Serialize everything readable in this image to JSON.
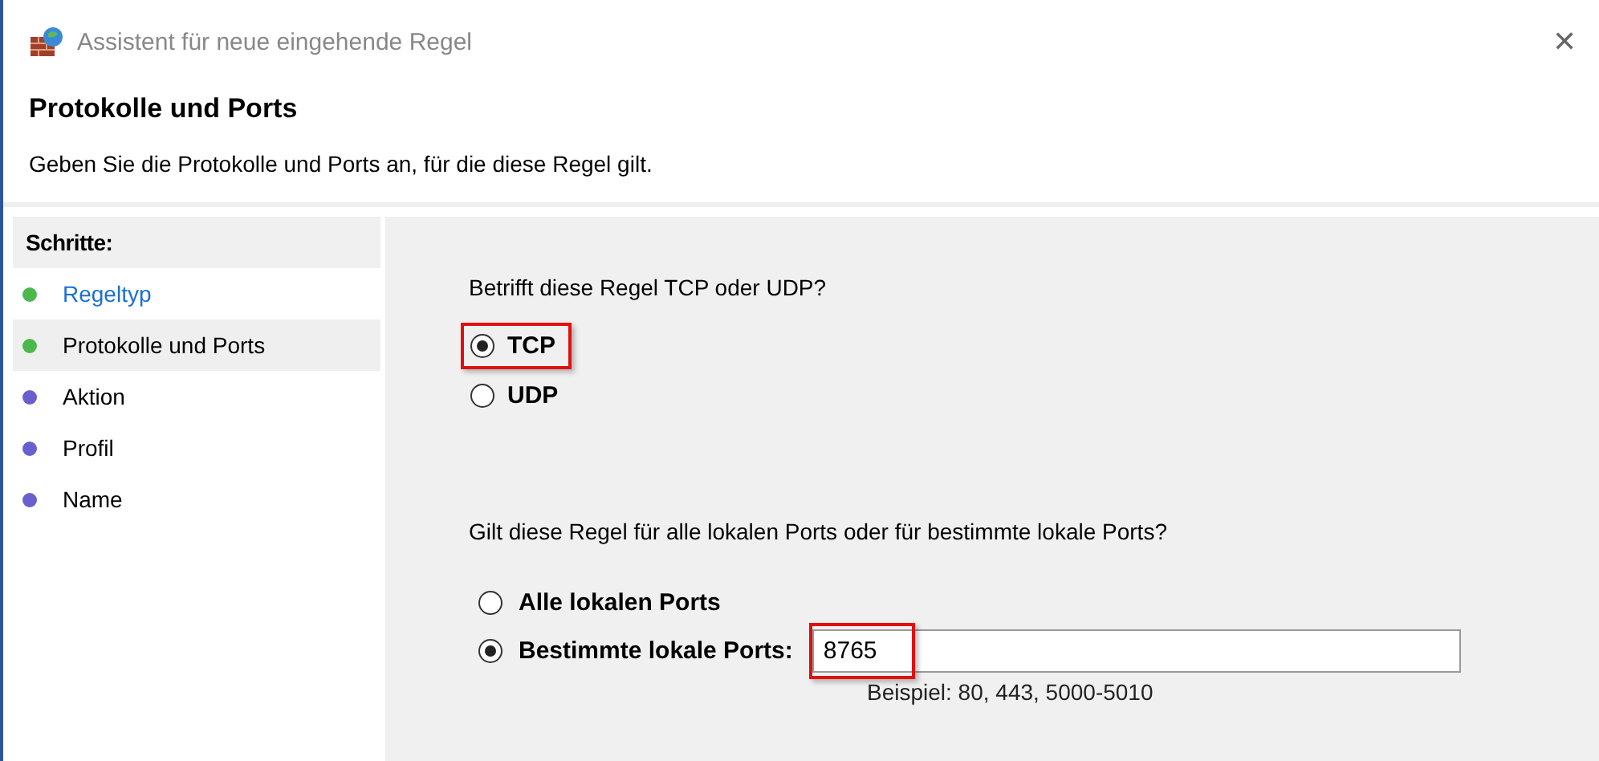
{
  "window": {
    "title": "Assistent für neue eingehende Regel",
    "close": "✕"
  },
  "header": {
    "title": "Protokolle und Ports",
    "description": "Geben Sie die Protokolle und Ports an, für die diese Regel gilt."
  },
  "steps": {
    "heading": "Schritte:",
    "items": [
      {
        "label": "Regeltyp",
        "color": "#4cb84c",
        "selected": false,
        "kind": "link"
      },
      {
        "label": "Protokolle und Ports",
        "color": "#4cb84c",
        "selected": true,
        "kind": "text"
      },
      {
        "label": "Aktion",
        "color": "#6a5fcf",
        "selected": false,
        "kind": "text"
      },
      {
        "label": "Profil",
        "color": "#6a5fcf",
        "selected": false,
        "kind": "text"
      },
      {
        "label": "Name",
        "color": "#6a5fcf",
        "selected": false,
        "kind": "text"
      }
    ]
  },
  "protocol": {
    "question": "Betrifft diese Regel TCP oder UDP?",
    "options": [
      {
        "label": "TCP",
        "selected": true,
        "highlighted": true
      },
      {
        "label": "UDP",
        "selected": false,
        "highlighted": false
      }
    ]
  },
  "ports": {
    "question": "Gilt diese Regel für alle lokalen Ports oder für bestimmte lokale Ports?",
    "options": [
      {
        "label": "Alle lokalen Ports",
        "selected": false,
        "kind": "plain"
      },
      {
        "label": "Bestimmte lokale Ports:",
        "selected": true,
        "kind": "field"
      }
    ],
    "field": {
      "value": "8765",
      "highlighted": true
    },
    "example": "Beispiel: 80, 443, 5000-5010"
  }
}
